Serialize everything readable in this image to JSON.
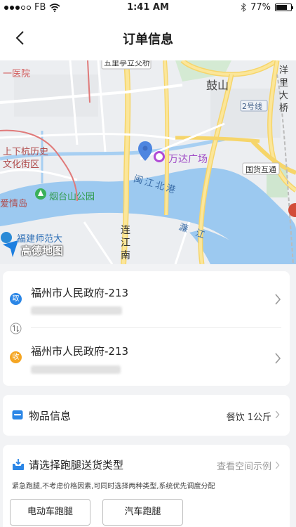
{
  "status_bar": {
    "carrier": "FB",
    "time": "1:41 AM",
    "battery": "77%",
    "battery_level": 0.77
  },
  "header": {
    "title": "订单信息"
  },
  "map": {
    "labels": {
      "top_road": "五里亭立交桥",
      "hospital": "一医院",
      "gushan": "鼓山",
      "yangli": "洋里大桥",
      "line2": "2号线",
      "shangxiahang": "上下杭历史文化街区",
      "shangxiahang_l1": "上下杭历史",
      "shangxiahang_l2": "文化街区",
      "wanda": "万达广场",
      "guohuo": "国货互通",
      "yantai": "烟台山公园",
      "minjiang": "闽江北港",
      "aiqing": "爱情岛",
      "fujian": "福建师范大",
      "lianjiang": "连江南",
      "lianjiang_1": "连",
      "lianjiang_2": "江",
      "lianjiang_3": "南",
      "pujiang": "濂江",
      "pujiang_1": "濂",
      "pujiang_2": "江"
    },
    "logo": "高德地图"
  },
  "pickup": {
    "badge": "取",
    "title": "福州市人民政府-213",
    "badge_color": "#2b86e6"
  },
  "delivery": {
    "badge": "收",
    "title": "福州市人民政府-213",
    "badge_color": "#f5a623"
  },
  "goods": {
    "label": "物品信息",
    "value": "餐饮 1公斤"
  },
  "delivery_type": {
    "title": "请选择跑腿送货类型",
    "link": "查看空间示例",
    "description": "紧急跑腿,不考虑价格因素,可同时选择两种类型,系统优先调度分配",
    "options": [
      "电动车跑腿",
      "汽车跑腿"
    ]
  }
}
